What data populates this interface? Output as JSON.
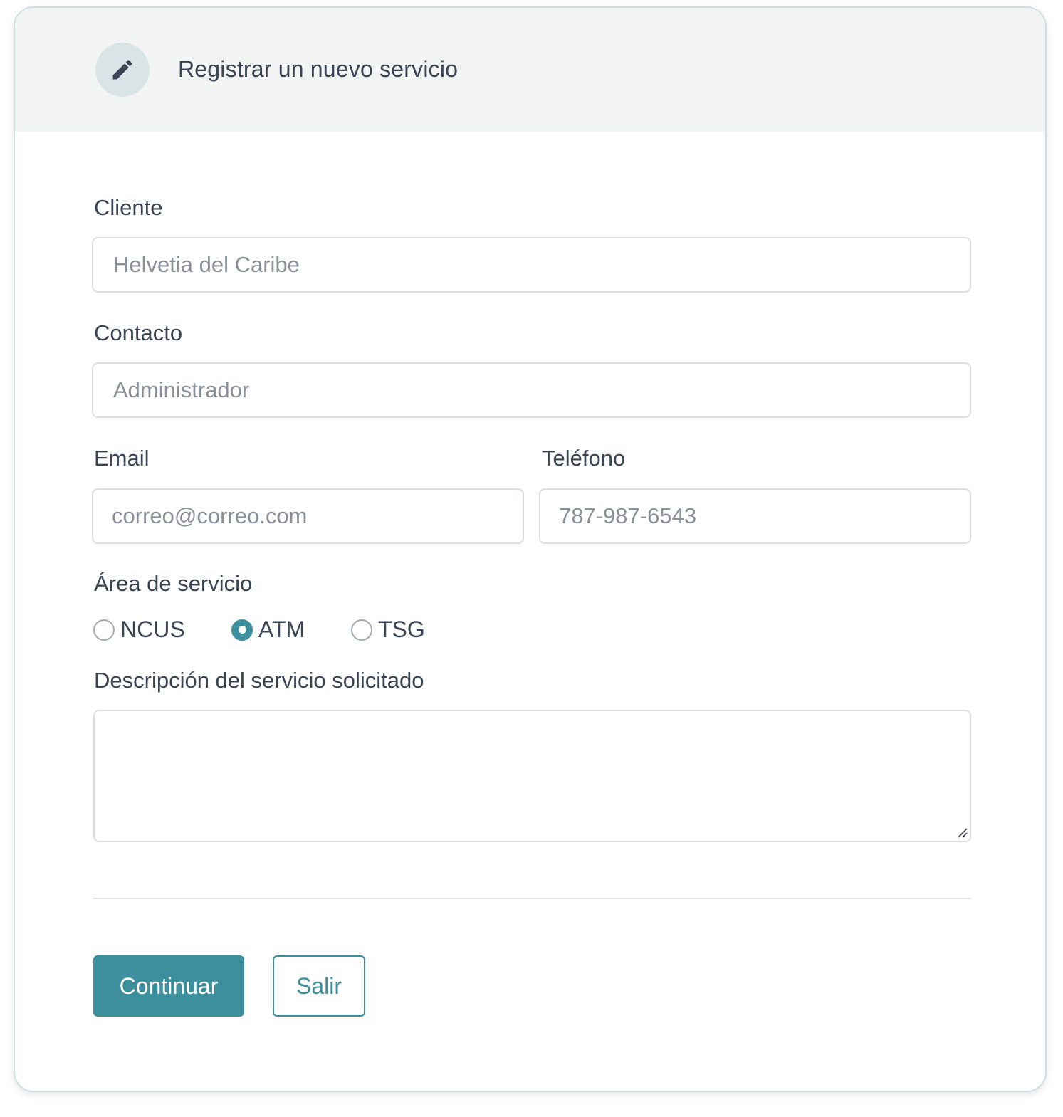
{
  "header": {
    "title": "Registrar un nuevo servicio",
    "icon": "pencil-icon"
  },
  "form": {
    "cliente": {
      "label": "Cliente",
      "placeholder": "Helvetia del Caribe",
      "value": ""
    },
    "contacto": {
      "label": "Contacto",
      "placeholder": "Administrador",
      "value": ""
    },
    "email": {
      "label": "Email",
      "placeholder": "correo@correo.com",
      "value": ""
    },
    "telefono": {
      "label": "Teléfono",
      "placeholder": "787-987-6543",
      "value": ""
    },
    "area": {
      "label": "Área de servicio",
      "options": [
        {
          "label": "NCUS",
          "checked": false
        },
        {
          "label": "ATM",
          "checked": true
        },
        {
          "label": "TSG",
          "checked": false
        }
      ]
    },
    "descripcion": {
      "label": "Descripción del servicio solicitado",
      "value": ""
    }
  },
  "actions": {
    "continue_label": "Continuar",
    "exit_label": "Salir"
  },
  "colors": {
    "accent": "#3e8f9d",
    "header_bg": "#f3f5f5",
    "text": "#3a4454"
  }
}
